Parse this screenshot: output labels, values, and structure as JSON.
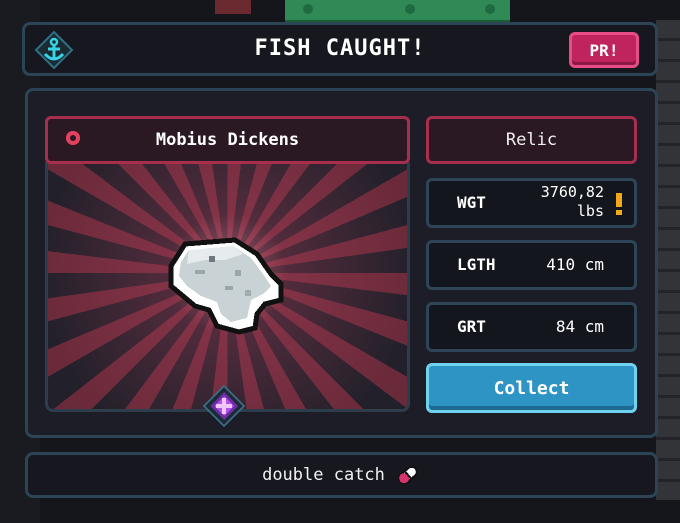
{
  "header": {
    "title": "FISH CAUGHT!",
    "emblem_icon": "anchor-icon",
    "pr_label": "PR!"
  },
  "fish": {
    "name": "Mobius Dickens",
    "rarity": "Relic",
    "sprite_icon": "fish-sprite-icon",
    "gem_icon": "purple-gem-icon"
  },
  "stats": {
    "weight_label": "WGT",
    "weight_value": "3760,82\nlbs",
    "length_label": "LGTH",
    "length_value": "410 cm",
    "girth_label": "GRT",
    "girth_value": "84 cm",
    "weight_warning_icon": "exclamation-icon"
  },
  "actions": {
    "collect_label": "Collect"
  },
  "footer": {
    "text": "double catch",
    "icon": "pill-icon"
  },
  "colors": {
    "accent_pink": "#c0245f",
    "rarity_border": "#a72f4d",
    "collect_blue": "#2e94c4",
    "panel_border": "#2b4556",
    "warning_orange": "#f3a91b"
  }
}
